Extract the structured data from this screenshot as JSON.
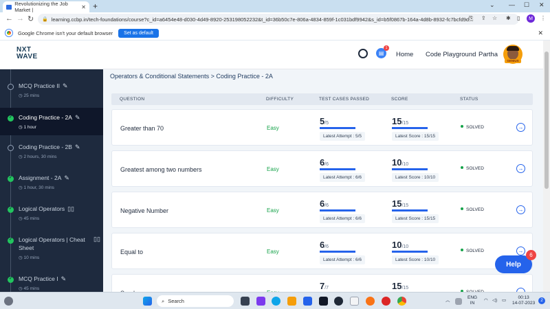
{
  "browser": {
    "tab_title": "Revolutionizing the Job Market | ",
    "tab_close": "✕",
    "new_tab": "+",
    "url": "learning.ccbp.in/tech-foundations/course?c_id=a6454e48-d030-4d49-8920-253198052232&t_id=36b50c7e-806a-4834-859f-1c031bdf9942&s_id=b5f0867b-164a-4d8b-8932-fc7bcfd9d...",
    "profile_initial": "M",
    "infobar_message": "Google Chrome isn't your default browser",
    "set_default_label": "Set as default"
  },
  "header": {
    "logo_top": "NXT",
    "logo_bottom": "WAVE",
    "chat_badge": "1",
    "nav": [
      "Home",
      "Code Playground"
    ],
    "user_name": "Partha",
    "user_tag": "GENIUS"
  },
  "sidebar": {
    "items": [
      {
        "title": "MCQ Practice II",
        "duration": "25 mins",
        "completed": false
      },
      {
        "title": "Coding Practice - 2A",
        "duration": "1 hour",
        "completed": true,
        "active": true
      },
      {
        "title": "Coding Practice - 2B",
        "duration": "2 hours, 30 mins",
        "completed": false
      },
      {
        "title": "Assignment - 2A",
        "duration": "1 hour, 30 mins",
        "completed": true
      },
      {
        "title": "Logical Operators",
        "duration": "45 mins",
        "completed": true
      },
      {
        "title": "Logical Operators | Cheat Sheet",
        "duration": "10 mins",
        "completed": true
      },
      {
        "title": "MCQ Practice I",
        "duration": "45 mins",
        "completed": true
      }
    ]
  },
  "main": {
    "breadcrumb": "Operators & Conditional Statements > Coding Practice - 2A",
    "columns": [
      "QUESTION",
      "DIFFICULTY",
      "TEST CASES PASSED",
      "SCORE",
      "STATUS"
    ],
    "rows": [
      {
        "question": "Greater than 70",
        "difficulty": "Easy",
        "passed": "5",
        "total": "/5",
        "latest_attempt": "Latest Attempt : 5/5",
        "score": "15",
        "score_total": "/15",
        "latest_score": "Latest Score : 15/15",
        "status": "SOLVED"
      },
      {
        "question": "Greatest among two numbers",
        "difficulty": "Easy",
        "passed": "6",
        "total": "/6",
        "latest_attempt": "Latest Attempt : 6/6",
        "score": "10",
        "score_total": "/10",
        "latest_score": "Latest Score : 10/10",
        "status": "SOLVED"
      },
      {
        "question": "Negative Number",
        "difficulty": "Easy",
        "passed": "6",
        "total": "/6",
        "latest_attempt": "Latest Attempt : 6/6",
        "score": "15",
        "score_total": "/15",
        "latest_score": "Latest Score : 15/15",
        "status": "SOLVED"
      },
      {
        "question": "Equal to",
        "difficulty": "Easy",
        "passed": "6",
        "total": "/6",
        "latest_attempt": "Latest Attempt : 6/6",
        "score": "10",
        "score_total": "/10",
        "latest_score": "Latest Score : 10/10",
        "status": "SOLVED"
      },
      {
        "question": "Sunday",
        "difficulty": "Easy",
        "passed": "7",
        "total": "/7",
        "latest_attempt": "",
        "score": "15",
        "score_total": "/15",
        "latest_score": "",
        "status": "SOLVED"
      }
    ],
    "help_label": "Help",
    "help_badge": "6"
  },
  "taskbar": {
    "search_placeholder": "Search",
    "lang_line1": "ENG",
    "lang_line2": "IN",
    "time": "00:13",
    "date": "14-07-2023",
    "notif": "2"
  }
}
